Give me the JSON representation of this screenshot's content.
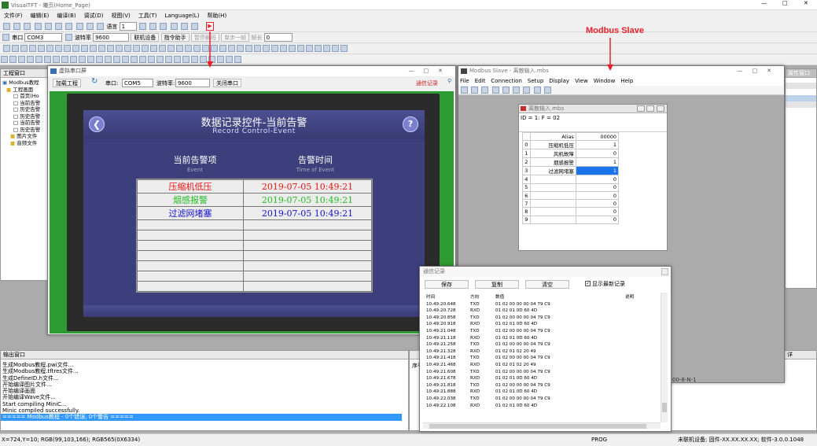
{
  "app": {
    "title": "VisualTFT - 曦页(Home_Page)"
  },
  "menu": [
    "文件(F)",
    "编辑(E)",
    "编译(B)",
    "调试(D)",
    "视图(V)",
    "工具(T)",
    "Language(L)",
    "帮助(H)"
  ],
  "toolbar2": {
    "port_label": "串口",
    "port": "COM3",
    "baud_label": "波特率",
    "baud": "9600",
    "connect": "联机设备",
    "wizard": "指令助手",
    "pause": "暂停解码",
    "step": "单步一帧",
    "frame_label": "帧长",
    "frame": "0"
  },
  "toolbar1": {
    "lang_label": "语言",
    "lang_value": "1"
  },
  "project_panel": {
    "title": "工程窗口",
    "root": "Modbus教程",
    "folder": "工程画面",
    "pages": [
      "首页(Ho",
      "当前告警",
      "历史告警",
      "历史告警",
      "当前告警",
      "历史告警"
    ],
    "folders2": [
      "图片文件",
      "音频文件"
    ]
  },
  "output_panel": {
    "title": "输出窗口",
    "lines": [
      "生成Modbus教程.pwi文件...",
      "生成Modbus教程.tftres文件...",
      "生成DefineID.h文件...",
      "开始编译图片文件...",
      "开始编译画面",
      "开始编译Wave文件...",
      "Start compiling MiniC...",
      "Minic compiled successfully."
    ],
    "highlight": "===== Modbus教程 - 0个错误, 0个警告 ====="
  },
  "status_bar": {
    "coords": "X=724,Y=10; RGB(99,103,166); RGB565(0X6334)",
    "mode": "PROG",
    "device": "未联机设备; 固件-XX.XX.XX.XX; 软件-3.0.0.1048"
  },
  "annotation": {
    "label": "Modbus Slave",
    "color": "#e8202a"
  },
  "virtual_port": {
    "title": "虚拟串口屏",
    "load_button": "加载工程",
    "port_label": "串口:",
    "port": "COM5",
    "baud_label": "波特率:",
    "baud": "9600",
    "close_button": "关闭串口",
    "comm_log_link": "通信记录",
    "screen": {
      "title_cn": "数据记录控件-当前告警",
      "title_en": "Record Control-Event",
      "col1_cn": "当前告警项",
      "col1_en": "Event",
      "col2_cn": "告警时间",
      "col2_en": "Time of Event",
      "rows": [
        {
          "event": "压缩机低压",
          "time": "2019-07-05  10:49:21",
          "color": "#ee1111"
        },
        {
          "event": "烟感报警",
          "time": "2019-07-05  10:49:21",
          "color": "#22bb22"
        },
        {
          "event": "过滤网堵塞",
          "time": "2019-07-05  10:49:21",
          "color": "#1111cc"
        }
      ],
      "empty_rows": 7
    }
  },
  "modbus_slave": {
    "title": "Modbus Slave - 离散输入.mbs",
    "menu": [
      "File",
      "Edit",
      "Connection",
      "Setup",
      "Display",
      "View",
      "Window",
      "Help"
    ],
    "child_title": "离散输入.mbs",
    "id_line": "ID = 1: F = 02",
    "col_alias": "Alias",
    "col_value": "00000",
    "rows": [
      {
        "n": "0",
        "alias": "压缩机低压",
        "value": "1"
      },
      {
        "n": "1",
        "alias": "风机故障",
        "value": "0"
      },
      {
        "n": "2",
        "alias": "烟感报警",
        "value": "1"
      },
      {
        "n": "3",
        "alias": "过滤网堵塞",
        "value": "1"
      },
      {
        "n": "4",
        "alias": "",
        "value": "0"
      },
      {
        "n": "5",
        "alias": "",
        "value": "0"
      },
      {
        "n": "6",
        "alias": "",
        "value": "0"
      },
      {
        "n": "7",
        "alias": "",
        "value": "0"
      },
      {
        "n": "8",
        "alias": "",
        "value": "0"
      },
      {
        "n": "9",
        "alias": "",
        "value": "0"
      }
    ],
    "status_fragment": "00-8-N-1"
  },
  "comm_log": {
    "title": "通信记录",
    "save": "保存",
    "copy": "复制",
    "clear": "清空",
    "show_latest": "显示最新记录",
    "show_latest_checked": true,
    "headers": [
      "时间",
      "方向",
      "数值",
      "说明"
    ],
    "rows": [
      [
        "10:49:20.648",
        "TXD",
        "01 02 00 00 00 04 79 C9"
      ],
      [
        "10:49:20.728",
        "RXD",
        "01 02 01 0D 60 4D"
      ],
      [
        "10:49:20.858",
        "TXD",
        "01 02 00 00 00 04 79 C9"
      ],
      [
        "10:49:20.918",
        "RXD",
        "01 02 01 0D 60 4D"
      ],
      [
        "10:49:21.048",
        "TXD",
        "01 02 00 00 00 04 79 C9"
      ],
      [
        "10:49:21.118",
        "RXD",
        "01 02 01 0D 60 4D"
      ],
      [
        "10:49:21.258",
        "TXD",
        "01 02 00 00 00 04 79 C9"
      ],
      [
        "10:49:21.328",
        "RXD",
        "01 02 01 02 20 49"
      ],
      [
        "10:49:21.418",
        "TXD",
        "01 02 00 00 00 04 79 C9"
      ],
      [
        "10:49:21.468",
        "RXD",
        "01 02 01 02 20 49"
      ],
      [
        "10:49:21.608",
        "TXD",
        "01 02 00 00 00 04 79 C9"
      ],
      [
        "10:49:21.678",
        "RXD",
        "01 02 01 0D 60 4D"
      ],
      [
        "10:49:21.818",
        "TXD",
        "01 02 00 00 00 04 79 C9"
      ],
      [
        "10:49:21.888",
        "RXD",
        "01 02 01 0D 60 4D"
      ],
      [
        "10:49:22.038",
        "TXD",
        "01 02 00 00 00 04 79 C9"
      ],
      [
        "10:49:22.108",
        "RXD",
        "01 02 01 0D 60 4D"
      ]
    ]
  },
  "right_panel": {
    "title_fragment": "属性窗口",
    "header_fragment": "序号",
    "detail_fragment": "详"
  }
}
